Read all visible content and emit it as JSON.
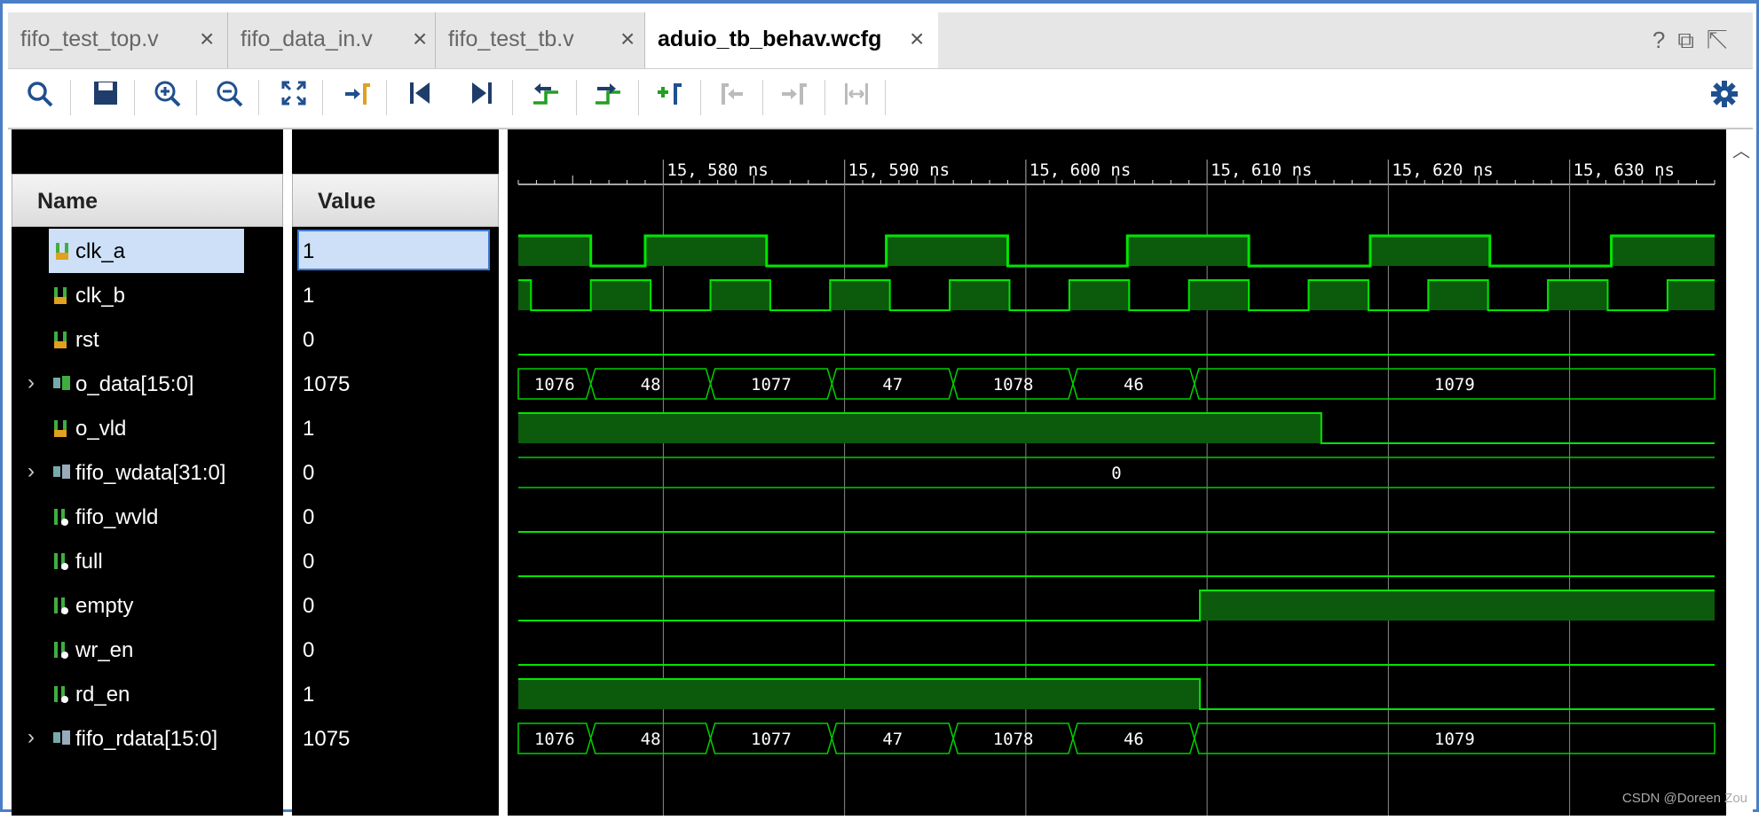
{
  "tabs": [
    {
      "label": "fifo_test_top.v",
      "active": false
    },
    {
      "label": "fifo_data_in.v",
      "active": false
    },
    {
      "label": "fifo_test_tb.v",
      "active": false
    },
    {
      "label": "aduio_tb_behav.wcfg",
      "active": true
    }
  ],
  "tab_close_glyph": "×",
  "window_buttons": [
    "?",
    "restore-icon",
    "maximize-icon"
  ],
  "toolbar": {
    "icons": [
      "search-icon",
      "save-icon",
      "zoom-in-icon",
      "zoom-out-icon",
      "zoom-fit-icon",
      "go-to-cursor-icon",
      "go-to-time-zero-icon",
      "go-to-last-time-icon",
      "previous-transition-icon",
      "next-transition-icon",
      "add-marker-icon",
      "previous-marker-icon",
      "next-marker-icon",
      "swap-cursors-icon",
      "settings-icon"
    ]
  },
  "headers": {
    "name": "Name",
    "value": "Value"
  },
  "signals": [
    {
      "name": "clk_a",
      "value": "1",
      "expandable": false,
      "kind": "input",
      "selected": true
    },
    {
      "name": "clk_b",
      "value": "1",
      "expandable": false,
      "kind": "input",
      "selected": false
    },
    {
      "name": "rst",
      "value": "0",
      "expandable": false,
      "kind": "input",
      "selected": false
    },
    {
      "name": "o_data[15:0]",
      "value": "1075",
      "expandable": true,
      "kind": "bus-in",
      "selected": false
    },
    {
      "name": "o_vld",
      "value": "1",
      "expandable": false,
      "kind": "input",
      "selected": false
    },
    {
      "name": "fifo_wdata[31:0]",
      "value": "0",
      "expandable": true,
      "kind": "bus-out",
      "selected": false
    },
    {
      "name": "fifo_wvld",
      "value": "0",
      "expandable": false,
      "kind": "output",
      "selected": false
    },
    {
      "name": "full",
      "value": "0",
      "expandable": false,
      "kind": "output",
      "selected": false
    },
    {
      "name": "empty",
      "value": "0",
      "expandable": false,
      "kind": "output",
      "selected": false
    },
    {
      "name": "wr_en",
      "value": "0",
      "expandable": false,
      "kind": "output",
      "selected": false
    },
    {
      "name": "rd_en",
      "value": "1",
      "expandable": false,
      "kind": "output",
      "selected": false
    },
    {
      "name": "fifo_rdata[15:0]",
      "value": "1075",
      "expandable": true,
      "kind": "bus-out",
      "selected": false
    }
  ],
  "waveform": {
    "time_start_ns": 15580,
    "ns_visible_start": 15572,
    "ns_visible_end": 15638,
    "time_labels": [
      "15, 580 ns",
      "15, 590 ns",
      "15, 600 ns",
      "15, 610 ns",
      "15, 620 ns",
      "15, 630 ns"
    ],
    "time_marks_ns": [
      15580,
      15590,
      15600,
      15610,
      15620,
      15630
    ],
    "clk_a_transitions_ns": [
      15572,
      15576,
      15579,
      15585.7,
      15592.3,
      15599,
      15605.6,
      15612.3,
      15619,
      15625.6,
      15632.3
    ],
    "clk_b_transitions_ns": [
      15572,
      15572.7,
      15576,
      15579.3,
      15582.6,
      15585.9,
      15589.2,
      15592.5,
      15595.8,
      15599.1,
      15602.4,
      15605.7,
      15609,
      15612.3,
      15615.6,
      15618.9,
      15622.2,
      15625.5,
      15628.8,
      15632.1,
      15635.4
    ],
    "o_data_segments": [
      {
        "label": "1076",
        "start": 15572,
        "end": 15576
      },
      {
        "label": "48",
        "start": 15576,
        "end": 15582.6
      },
      {
        "label": "1077",
        "start": 15582.6,
        "end": 15589.3
      },
      {
        "label": "47",
        "start": 15589.3,
        "end": 15596
      },
      {
        "label": "1078",
        "start": 15596,
        "end": 15602.6
      },
      {
        "label": "46",
        "start": 15602.6,
        "end": 15609.3
      },
      {
        "label": "1079",
        "start": 15609.3,
        "end": 15638
      }
    ],
    "fifo_wdata_label": "0",
    "o_vld_fall_ns": 15616.3,
    "empty_rise_ns": 15609.6,
    "rd_en_fall_ns": 15609.6,
    "colors": {
      "wave": "#00e600",
      "fill": "#0c5a0c",
      "grid": "#8a8a8a",
      "bus": "#00d000"
    }
  },
  "watermark": "CSDN @Doreen Zou"
}
